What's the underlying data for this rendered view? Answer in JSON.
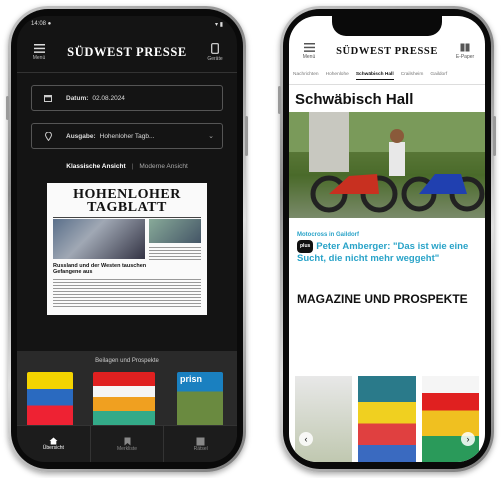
{
  "left_phone": {
    "header": {
      "menu_label": "Menü",
      "logo_text": "SÜDWEST PRESSE",
      "device_label": "Geräte"
    },
    "date_field": {
      "label": "Datum:",
      "value": "02.08.2024"
    },
    "edition_field": {
      "label": "Ausgabe:",
      "value": "Hohenloher Tagb..."
    },
    "view_toggle": {
      "classic": "Klassische Ansicht",
      "modern": "Moderne Ansicht"
    },
    "newspaper": {
      "masthead_line1": "HOHENLOHER",
      "masthead_line2": "TAGBLATT",
      "headline": "Russland und der Westen tauschen Gefangene aus"
    },
    "supplements": {
      "title": "Beilagen und Prospekte",
      "partial_label": "prisn"
    },
    "tabbar": [
      {
        "label": "Übersicht",
        "icon": "home-icon"
      },
      {
        "label": "Merkliste",
        "icon": "bookmark-icon"
      },
      {
        "label": "Rätsel",
        "icon": "puzzle-icon"
      }
    ]
  },
  "right_phone": {
    "header": {
      "menu_label": "Menü",
      "logo_text": "SÜDWEST PRESSE",
      "device_label": "E-Paper"
    },
    "tabs": [
      "Nachrichten",
      "Hohenlohe",
      "Schwäbisch Hall",
      "Crailsheim",
      "Gaildorf"
    ],
    "active_tab": "Schwäbisch Hall",
    "section_title": "Schwäbisch Hall",
    "article": {
      "kicker": "Motocross in Gaildorf",
      "badge": "plus",
      "headline": "Peter Amberger: \"Das ist wie eine Sucht, die nicht mehr weggeht\""
    },
    "magazines_title": "MAGAZINE UND PROSPEKTE"
  },
  "colors": {
    "left_bg": "#141414",
    "accent_blue": "#29a3c8",
    "right_bg": "#ffffff"
  }
}
